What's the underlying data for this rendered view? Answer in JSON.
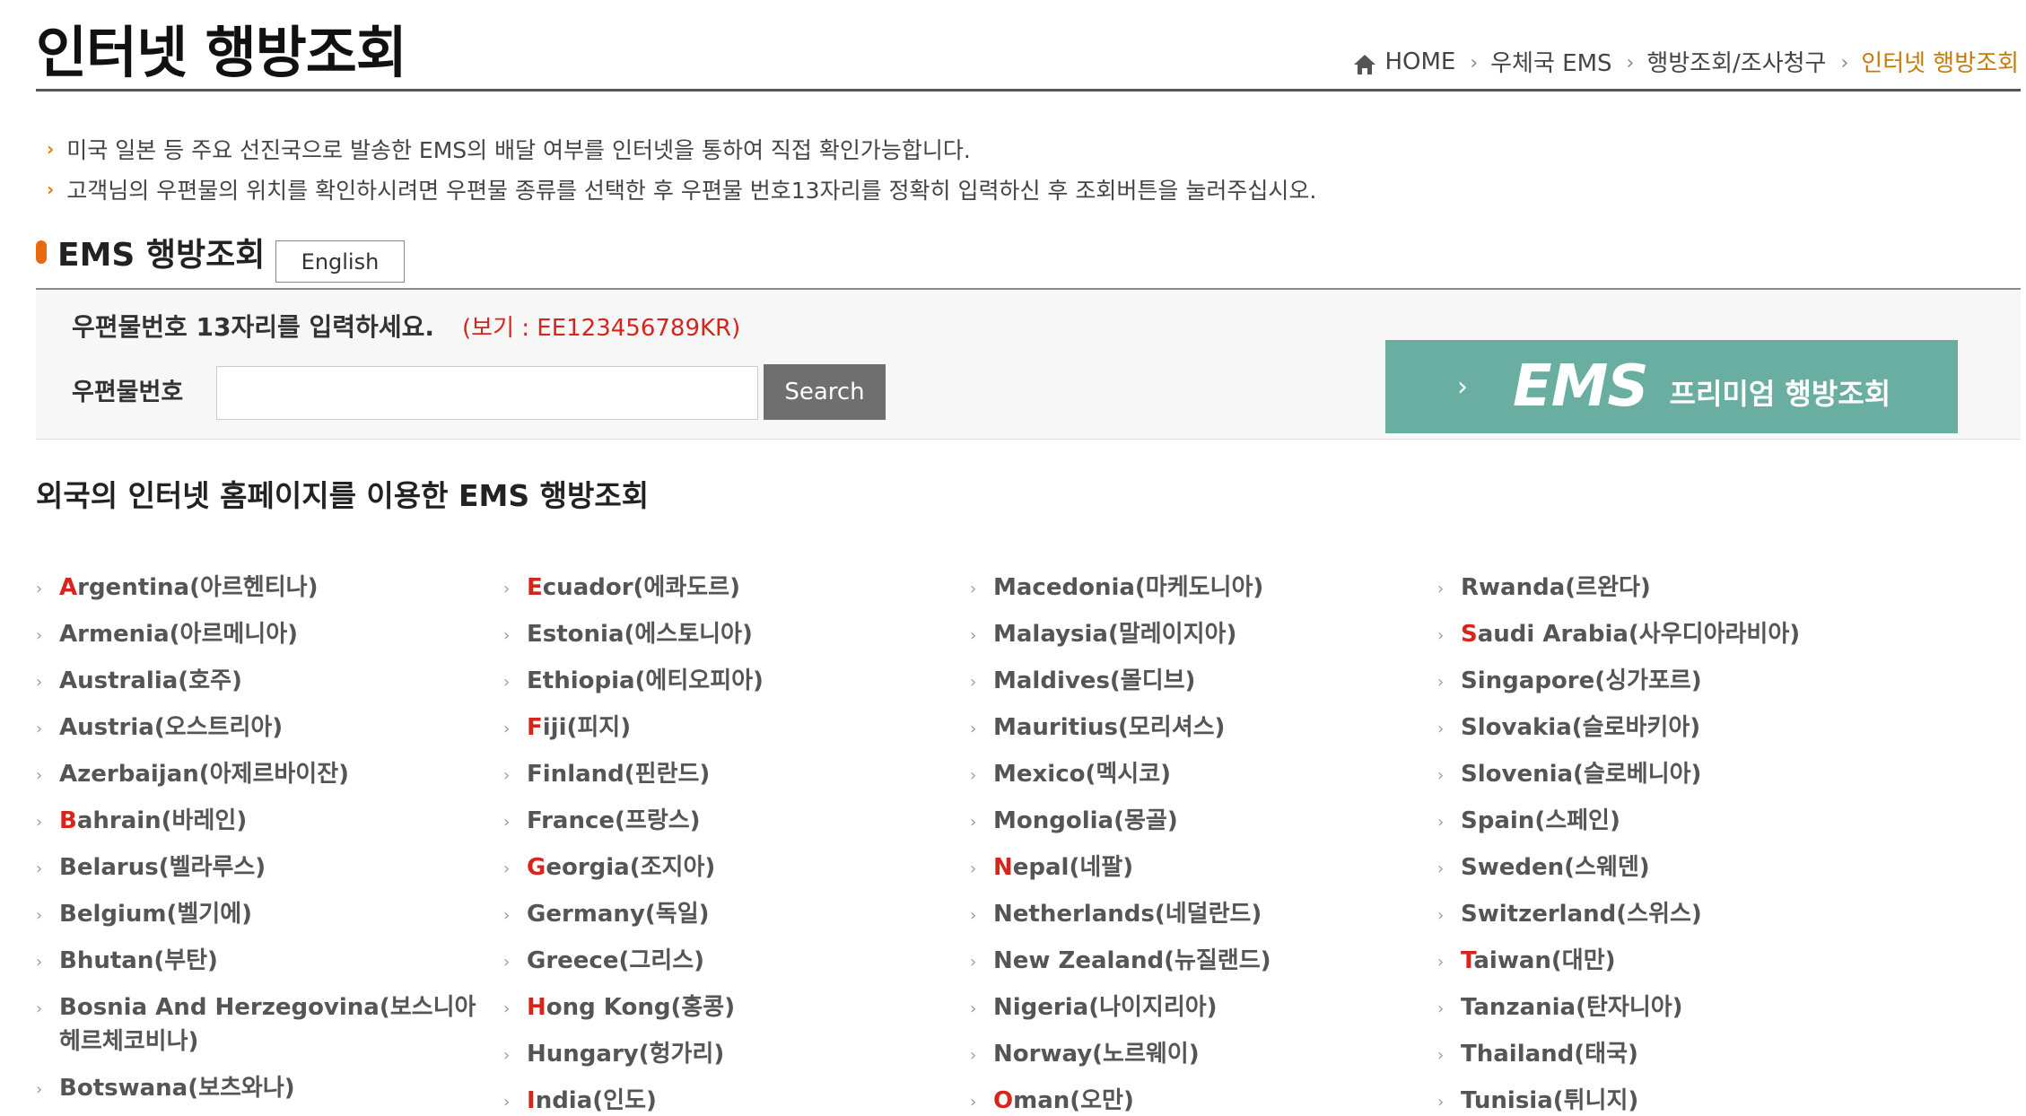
{
  "header": {
    "title": "인터넷 행방조회",
    "breadcrumb": [
      "HOME",
      "우체국 EMS",
      "행방조회/조사청구",
      "인터넷 행방조회"
    ]
  },
  "notices": [
    "미국 일본 등 주요 선진국으로 발송한 EMS의 배달 여부를 인터넷을 통하여 직접 확인가능합니다.",
    "고객님의 우편물의 위치를 확인하시려면 우편물 종류를 선택한 후 우편물 번호13자리를 정확히 입력하신 후 조회버튼을 눌러주십시오."
  ],
  "section": {
    "title": "EMS 행방조회",
    "english_button": "English"
  },
  "search": {
    "instruction": "우편물번호 13자리를 입력하세요.",
    "example": "(보기 : EE123456789KR)",
    "label": "우편물번호",
    "input_value": "",
    "button_label": "Search"
  },
  "premium": {
    "chevron": "›",
    "ems": "EMS",
    "text": "프리미엄 행방조회"
  },
  "foreign": {
    "title": "외국의 인터넷 홈페이지를 이용한 EMS 행방조회",
    "columns": [
      [
        {
          "initial": "A",
          "rest": "rgentina(아르헨티나)",
          "highlight": true
        },
        {
          "initial": "A",
          "rest": "rmenia(아르메니아)",
          "highlight": false
        },
        {
          "initial": "A",
          "rest": "ustralia(호주)",
          "highlight": false
        },
        {
          "initial": "A",
          "rest": "ustria(오스트리아)",
          "highlight": false
        },
        {
          "initial": "A",
          "rest": "zerbaijan(아제르바이잔)",
          "highlight": false
        },
        {
          "initial": "B",
          "rest": "ahrain(바레인)",
          "highlight": true
        },
        {
          "initial": "B",
          "rest": "elarus(벨라루스)",
          "highlight": false
        },
        {
          "initial": "B",
          "rest": "elgium(벨기에)",
          "highlight": false
        },
        {
          "initial": "B",
          "rest": "hutan(부탄)",
          "highlight": false
        },
        {
          "initial": "B",
          "rest": "osnia And Herzegovina(보스니아헤르체코비나)",
          "highlight": false
        },
        {
          "initial": "B",
          "rest": "otswana(보츠와나)",
          "highlight": false
        }
      ],
      [
        {
          "initial": "E",
          "rest": "cuador(에콰도르)",
          "highlight": true
        },
        {
          "initial": "E",
          "rest": "stonia(에스토니아)",
          "highlight": false
        },
        {
          "initial": "E",
          "rest": "thiopia(에티오피아)",
          "highlight": false
        },
        {
          "initial": "F",
          "rest": "iji(피지)",
          "highlight": true
        },
        {
          "initial": "F",
          "rest": "inland(핀란드)",
          "highlight": false
        },
        {
          "initial": "F",
          "rest": "rance(프랑스)",
          "highlight": false
        },
        {
          "initial": "G",
          "rest": "eorgia(조지아)",
          "highlight": true
        },
        {
          "initial": "G",
          "rest": "ermany(독일)",
          "highlight": false
        },
        {
          "initial": "G",
          "rest": "reece(그리스)",
          "highlight": false
        },
        {
          "initial": "H",
          "rest": "ong Kong(홍콩)",
          "highlight": true
        },
        {
          "initial": "H",
          "rest": "ungary(헝가리)",
          "highlight": false
        },
        {
          "initial": "I",
          "rest": "ndia(인도)",
          "highlight": true
        }
      ],
      [
        {
          "initial": "M",
          "rest": "acedonia(마케도니아)",
          "highlight": false
        },
        {
          "initial": "M",
          "rest": "alaysia(말레이지아)",
          "highlight": false
        },
        {
          "initial": "M",
          "rest": "aldives(몰디브)",
          "highlight": false
        },
        {
          "initial": "M",
          "rest": "auritius(모리셔스)",
          "highlight": false
        },
        {
          "initial": "M",
          "rest": "exico(멕시코)",
          "highlight": false
        },
        {
          "initial": "M",
          "rest": "ongolia(몽골)",
          "highlight": false
        },
        {
          "initial": "N",
          "rest": "epal(네팔)",
          "highlight": true
        },
        {
          "initial": "N",
          "rest": "etherlands(네덜란드)",
          "highlight": false
        },
        {
          "initial": "N",
          "rest": "ew Zealand(뉴질랜드)",
          "highlight": false
        },
        {
          "initial": "N",
          "rest": "igeria(나이지리아)",
          "highlight": false
        },
        {
          "initial": "N",
          "rest": "orway(노르웨이)",
          "highlight": false
        },
        {
          "initial": "O",
          "rest": "man(오만)",
          "highlight": true
        }
      ],
      [
        {
          "initial": "R",
          "rest": "wanda(르완다)",
          "highlight": false
        },
        {
          "initial": "S",
          "rest": "audi Arabia(사우디아라비아)",
          "highlight": true
        },
        {
          "initial": "S",
          "rest": "ingapore(싱가포르)",
          "highlight": false
        },
        {
          "initial": "S",
          "rest": "lovakia(슬로바키아)",
          "highlight": false
        },
        {
          "initial": "S",
          "rest": "lovenia(슬로베니아)",
          "highlight": false
        },
        {
          "initial": "S",
          "rest": "pain(스페인)",
          "highlight": false
        },
        {
          "initial": "S",
          "rest": "weden(스웨덴)",
          "highlight": false
        },
        {
          "initial": "S",
          "rest": "witzerland(스위스)",
          "highlight": false
        },
        {
          "initial": "T",
          "rest": "aiwan(대만)",
          "highlight": true
        },
        {
          "initial": "T",
          "rest": "anzania(탄자니아)",
          "highlight": false
        },
        {
          "initial": "T",
          "rest": "hailand(태국)",
          "highlight": false
        },
        {
          "initial": "T",
          "rest": "unisia(튀니지)",
          "highlight": false
        }
      ]
    ]
  },
  "colors": {
    "accent_orange": "#e86a0f",
    "breadcrumb_current": "#c57a0e",
    "highlight_red": "#d6251c",
    "premium_teal": "#6aada1",
    "search_button": "#6f6f6f"
  }
}
